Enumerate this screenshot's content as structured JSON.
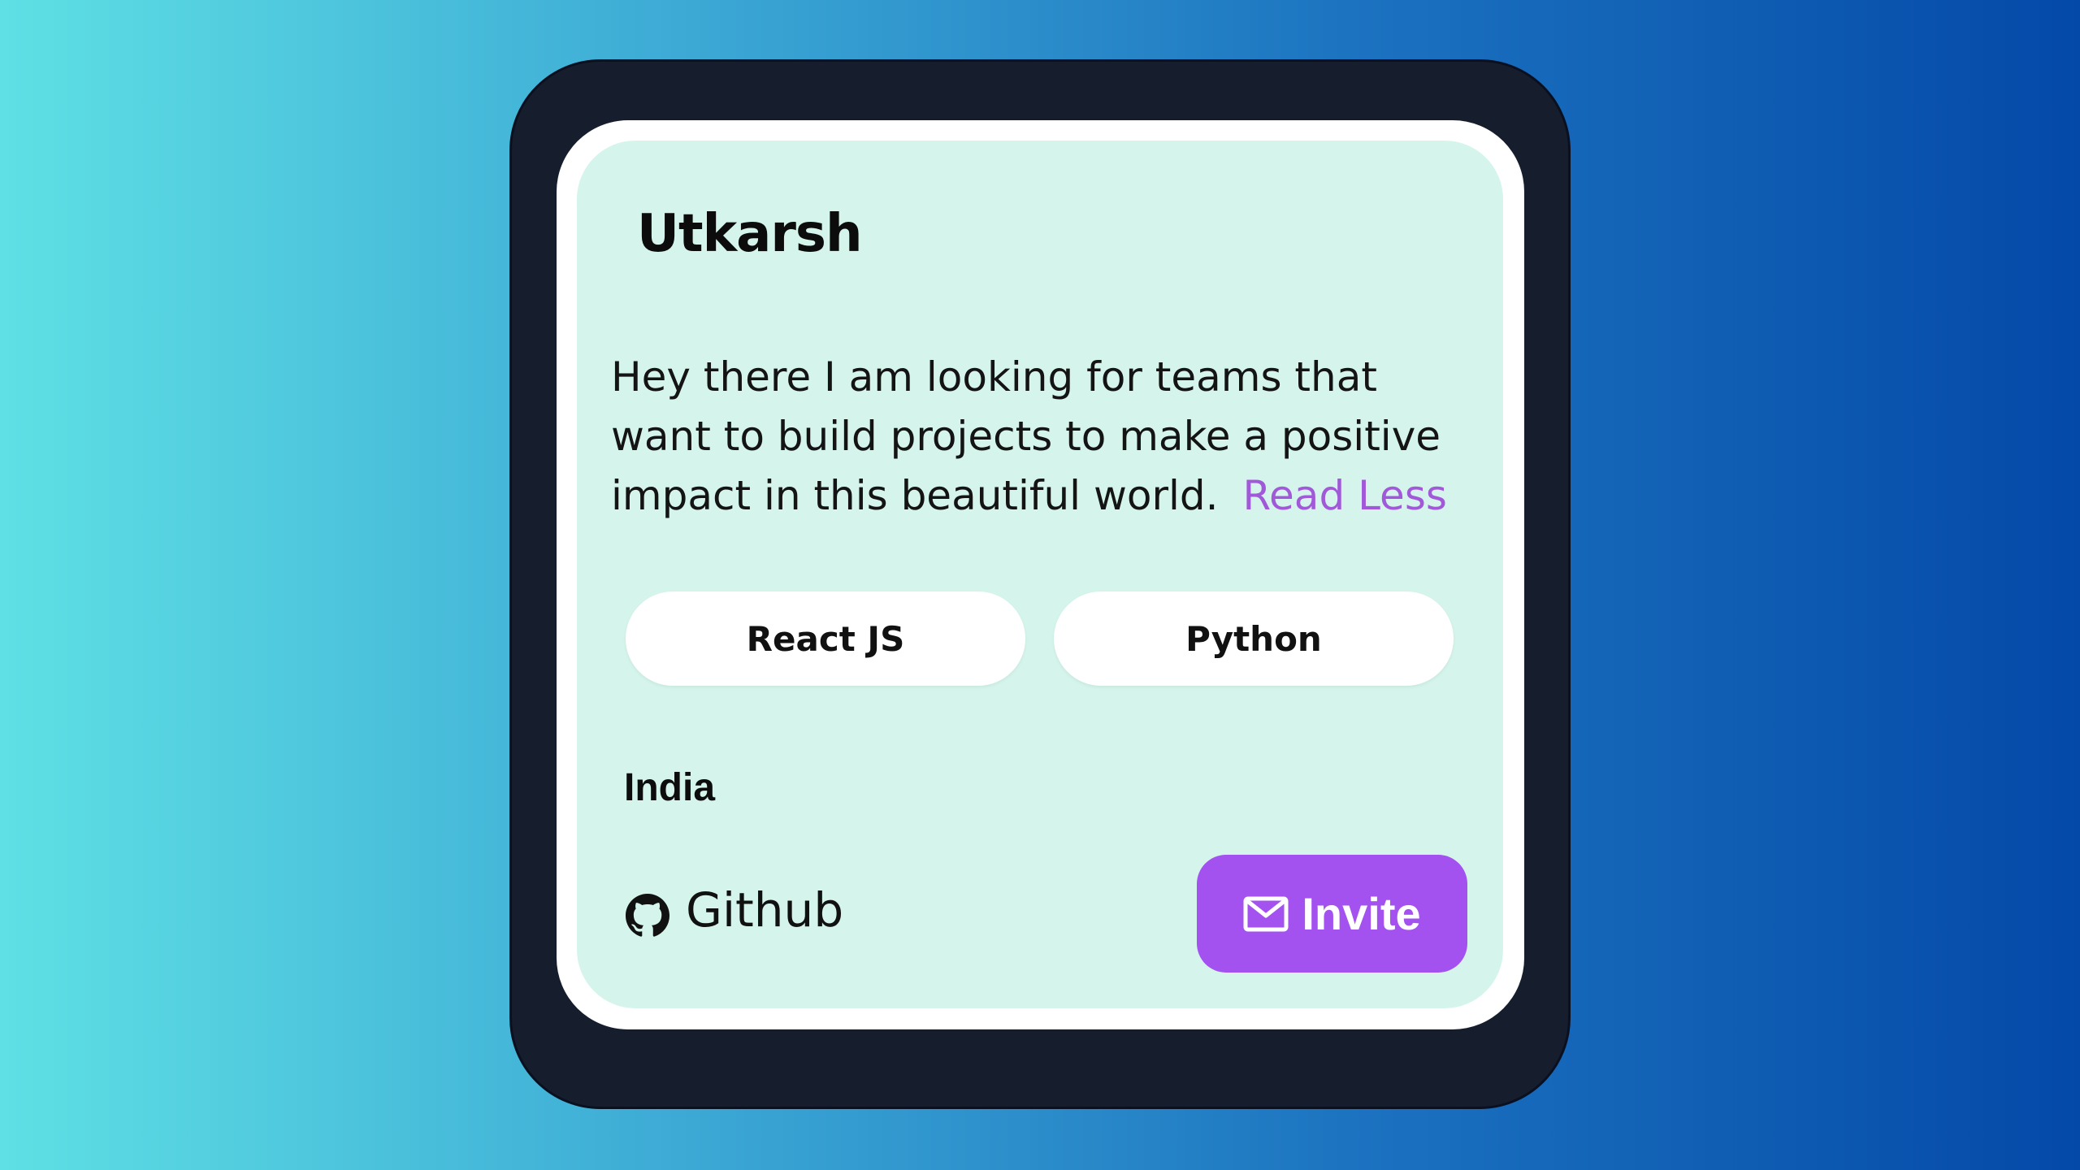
{
  "profile": {
    "name": "Utkarsh",
    "bio": "Hey there I am looking for teams that want to build projects to make a positive impact in this beautiful world.",
    "read_less_label": "Read Less",
    "skills": [
      "React JS",
      "Python"
    ],
    "location": "India",
    "github_label": "Github",
    "github_icon": "github-icon",
    "invite_label": "Invite",
    "invite_icon": "mail-icon"
  },
  "colors": {
    "card_background": "#d5f5ec",
    "device_frame": "#161e2e",
    "accent": "#a352ef",
    "link": "#a259d9"
  }
}
